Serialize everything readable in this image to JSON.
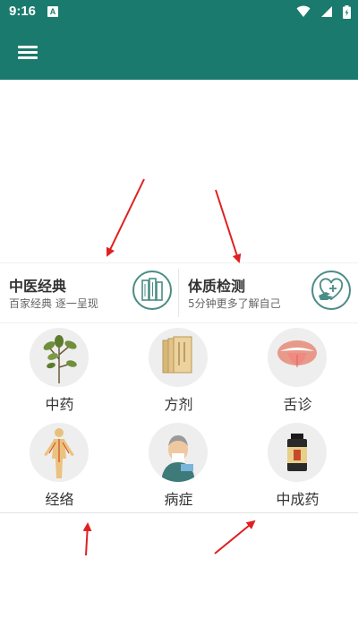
{
  "status_bar": {
    "time": "9:16",
    "notification_icon": "A",
    "icons": [
      "wifi-icon",
      "signal-icon",
      "battery-icon"
    ]
  },
  "app_bar": {
    "color": "#1a7a6d",
    "menu_icon": "hamburger-menu-icon"
  },
  "features": [
    {
      "title": "中医经典",
      "subtitle": "百家经典 逐一呈现",
      "icon": "books-icon"
    },
    {
      "title": "体质检测",
      "subtitle": "5分钟更多了解自己",
      "icon": "heart-hand-icon"
    }
  ],
  "grid": [
    {
      "label": "中药",
      "icon": "herb-plant-icon"
    },
    {
      "label": "方剂",
      "icon": "prescription-scroll-icon"
    },
    {
      "label": "舌诊",
      "icon": "tongue-icon"
    },
    {
      "label": "经络",
      "icon": "meridian-body-icon"
    },
    {
      "label": "病症",
      "icon": "sick-person-icon"
    },
    {
      "label": "中成药",
      "icon": "medicine-bottle-icon"
    }
  ],
  "colors": {
    "primary": "#1a7a6d",
    "annotation_arrow": "#e02020"
  }
}
